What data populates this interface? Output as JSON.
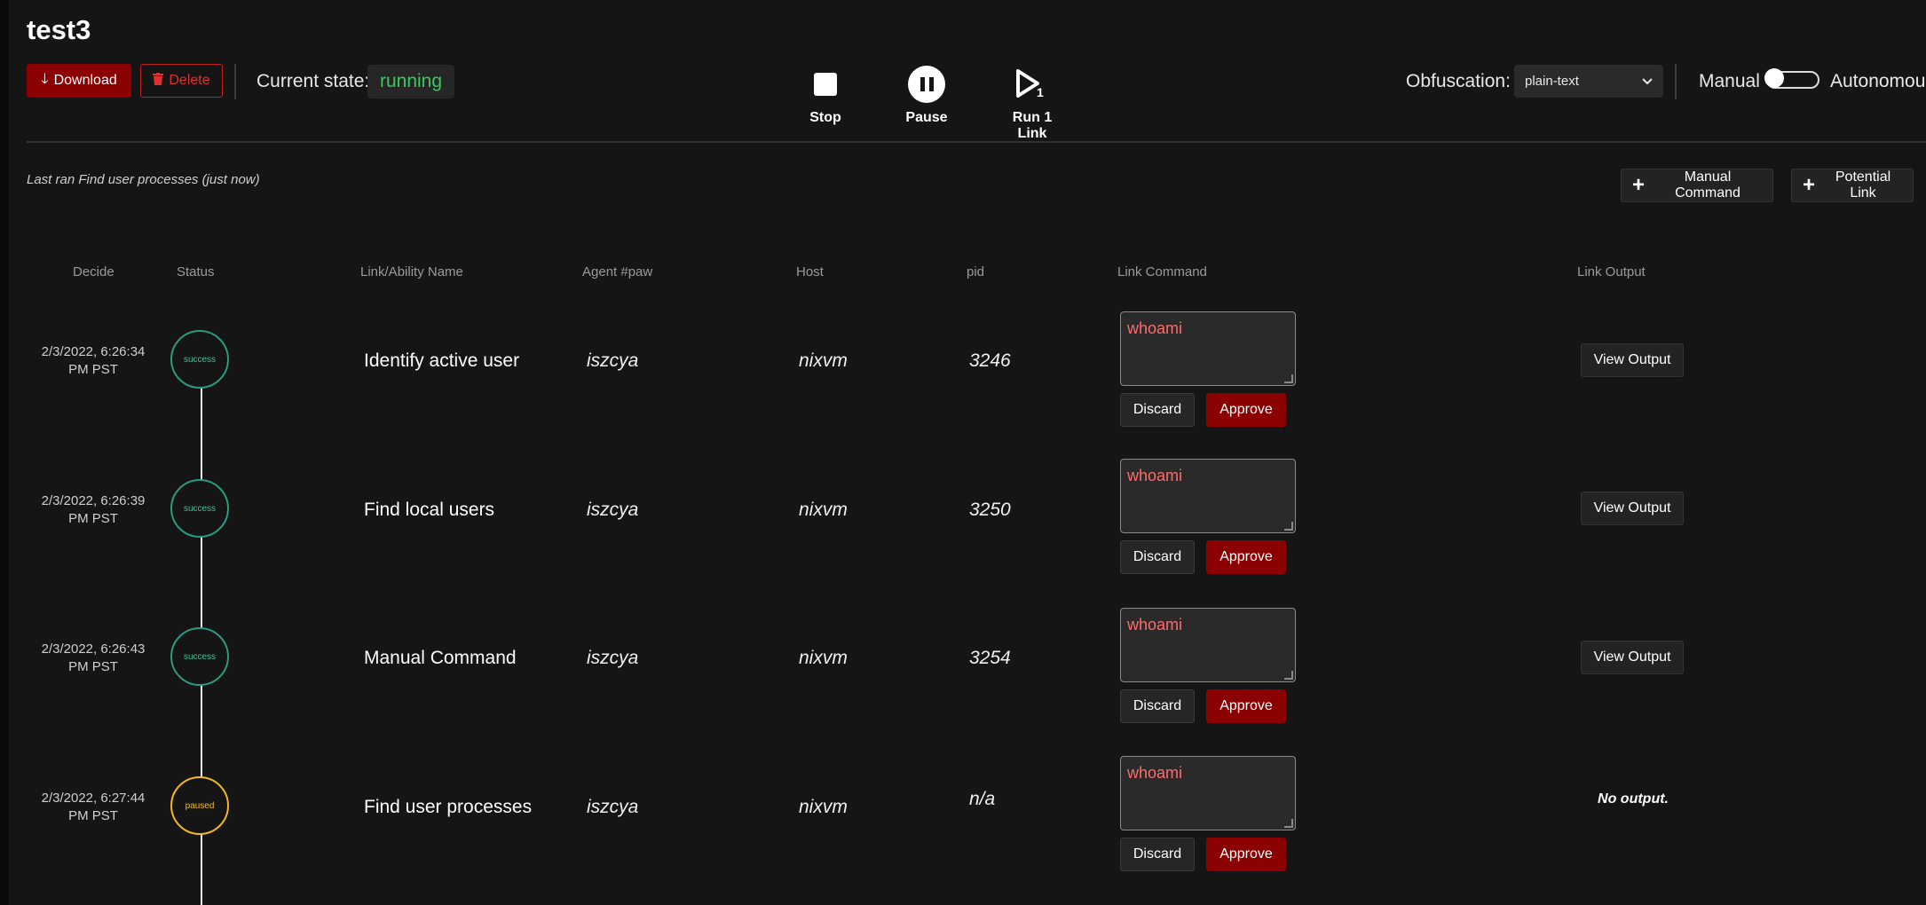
{
  "operation": {
    "title": "test3"
  },
  "toolbar": {
    "download_label": "Download",
    "delete_label": "Delete",
    "state_label": "Current state:",
    "state_value": "running",
    "stop_label": "Stop",
    "pause_label": "Pause",
    "run_label": "Run 1 Link",
    "run_count": "1",
    "obfuscation_label": "Obfuscation:",
    "obfuscation_value": "plain-text",
    "manual_label": "Manual",
    "autonomous_label": "Autonomous"
  },
  "status_bar": {
    "last_ran": "Last ran Find user processes (just now)",
    "manual_command_label": "Manual Command",
    "potential_link_label": "Potential Link"
  },
  "table": {
    "headers": [
      "Decide",
      "Status",
      "Link/Ability Name",
      "Agent #paw",
      "Host",
      "pid",
      "Link Command",
      "Link Output"
    ],
    "rows": [
      {
        "time_1": "2/3/2022, 6:26:34",
        "time_2": "PM PST",
        "status": "success",
        "name": "Identify active user",
        "paw": "iszcya",
        "host": "nixvm",
        "pid": "3246",
        "command": "whoami",
        "discard": "Discard",
        "approve": "Approve",
        "output": "View Output"
      },
      {
        "time_1": "2/3/2022, 6:26:39",
        "time_2": "PM PST",
        "status": "success",
        "name": "Find local users",
        "paw": "iszcya",
        "host": "nixvm",
        "pid": "3250",
        "command": "whoami",
        "discard": "Discard",
        "approve": "Approve",
        "output": "View Output"
      },
      {
        "time_1": "2/3/2022, 6:26:43",
        "time_2": "PM PST",
        "status": "success",
        "name": "Manual Command",
        "paw": "iszcya",
        "host": "nixvm",
        "pid": "3254",
        "command": "whoami",
        "discard": "Discard",
        "approve": "Approve",
        "output": "View Output"
      },
      {
        "time_1": "2/3/2022, 6:27:44",
        "time_2": "PM PST",
        "status": "paused",
        "name": "Find user processes",
        "paw": "iszcya",
        "host": "nixvm",
        "pid": "n/a",
        "command": "whoami",
        "discard": "Discard",
        "approve": "Approve",
        "output": "No output."
      }
    ]
  },
  "colors": {
    "accent_red": "#8b0000",
    "success": "#2b9a80",
    "paused": "#f2b91c",
    "running": "#3ec75e",
    "command_text": "#ff6b6b"
  },
  "icons": [
    "download-icon",
    "trash-icon",
    "stop-icon",
    "pause-icon",
    "play-icon",
    "chevron-down-icon",
    "plus-icon"
  ]
}
